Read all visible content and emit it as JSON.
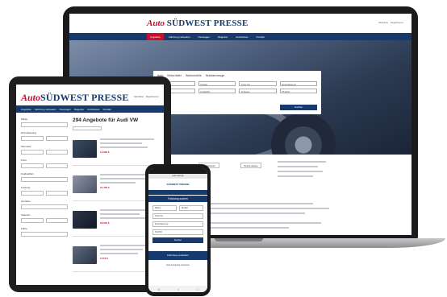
{
  "brand": {
    "auto": "Auto",
    "name": "SÜDWEST PRESSE",
    "primary_color": "#163a6e",
    "accent_color": "#c8102e"
  },
  "laptop": {
    "header_links": "Merkliste · Registrieren",
    "nav": [
      "Angebote",
      "Fahrzeug verkaufen",
      "Neuwagen",
      "Ratgeber",
      "Autohäuser",
      "Kontakt"
    ],
    "search": {
      "tabs": [
        "Auto",
        "Motorräder",
        "Wohnmobile",
        "Nutzfahrzeuge"
      ],
      "fields": [
        "Marke",
        "Modell",
        "Preis bis",
        "Erstzulassung",
        "Kilometer",
        "Kraftstoff",
        "Umkreis",
        "PLZ/Ort"
      ],
      "button": "Suchen"
    },
    "pills": [
      "aktualisieren",
      "Suche starten"
    ]
  },
  "tablet": {
    "header_links": "Merkliste · Registrieren",
    "nav": [
      "Angebote",
      "Fahrzeug verkaufen",
      "Neuwagen",
      "Ratgeber",
      "Autohäuser",
      "Kontakt"
    ],
    "filters": [
      "Marke",
      "Erstzulassung",
      "Kilometer",
      "Preis",
      "Kraftstoffart",
      "Leistung",
      "Getriebe",
      "Standort",
      "Farbe"
    ],
    "result_count": "294 Angebote für Audi VW",
    "listings": [
      {
        "price": "14.990 €"
      },
      {
        "price": "21.450 €"
      },
      {
        "price": "18.900 €"
      },
      {
        "price": "9.750 €"
      }
    ]
  },
  "phone": {
    "url": "auto.swp.de",
    "logo": "SÜDWEST PRESSE",
    "banner": "Fahrzeug suchen",
    "fields": [
      "Marke",
      "Modell",
      "Preis bis",
      "Erstzulassung",
      "PLZ/Ort"
    ],
    "button": "Suchen",
    "section": "Fahrzeug verkaufen",
    "footer": "Jetzt kostenlos inserieren",
    "navbar": [
      "◁",
      "○",
      "□"
    ]
  }
}
